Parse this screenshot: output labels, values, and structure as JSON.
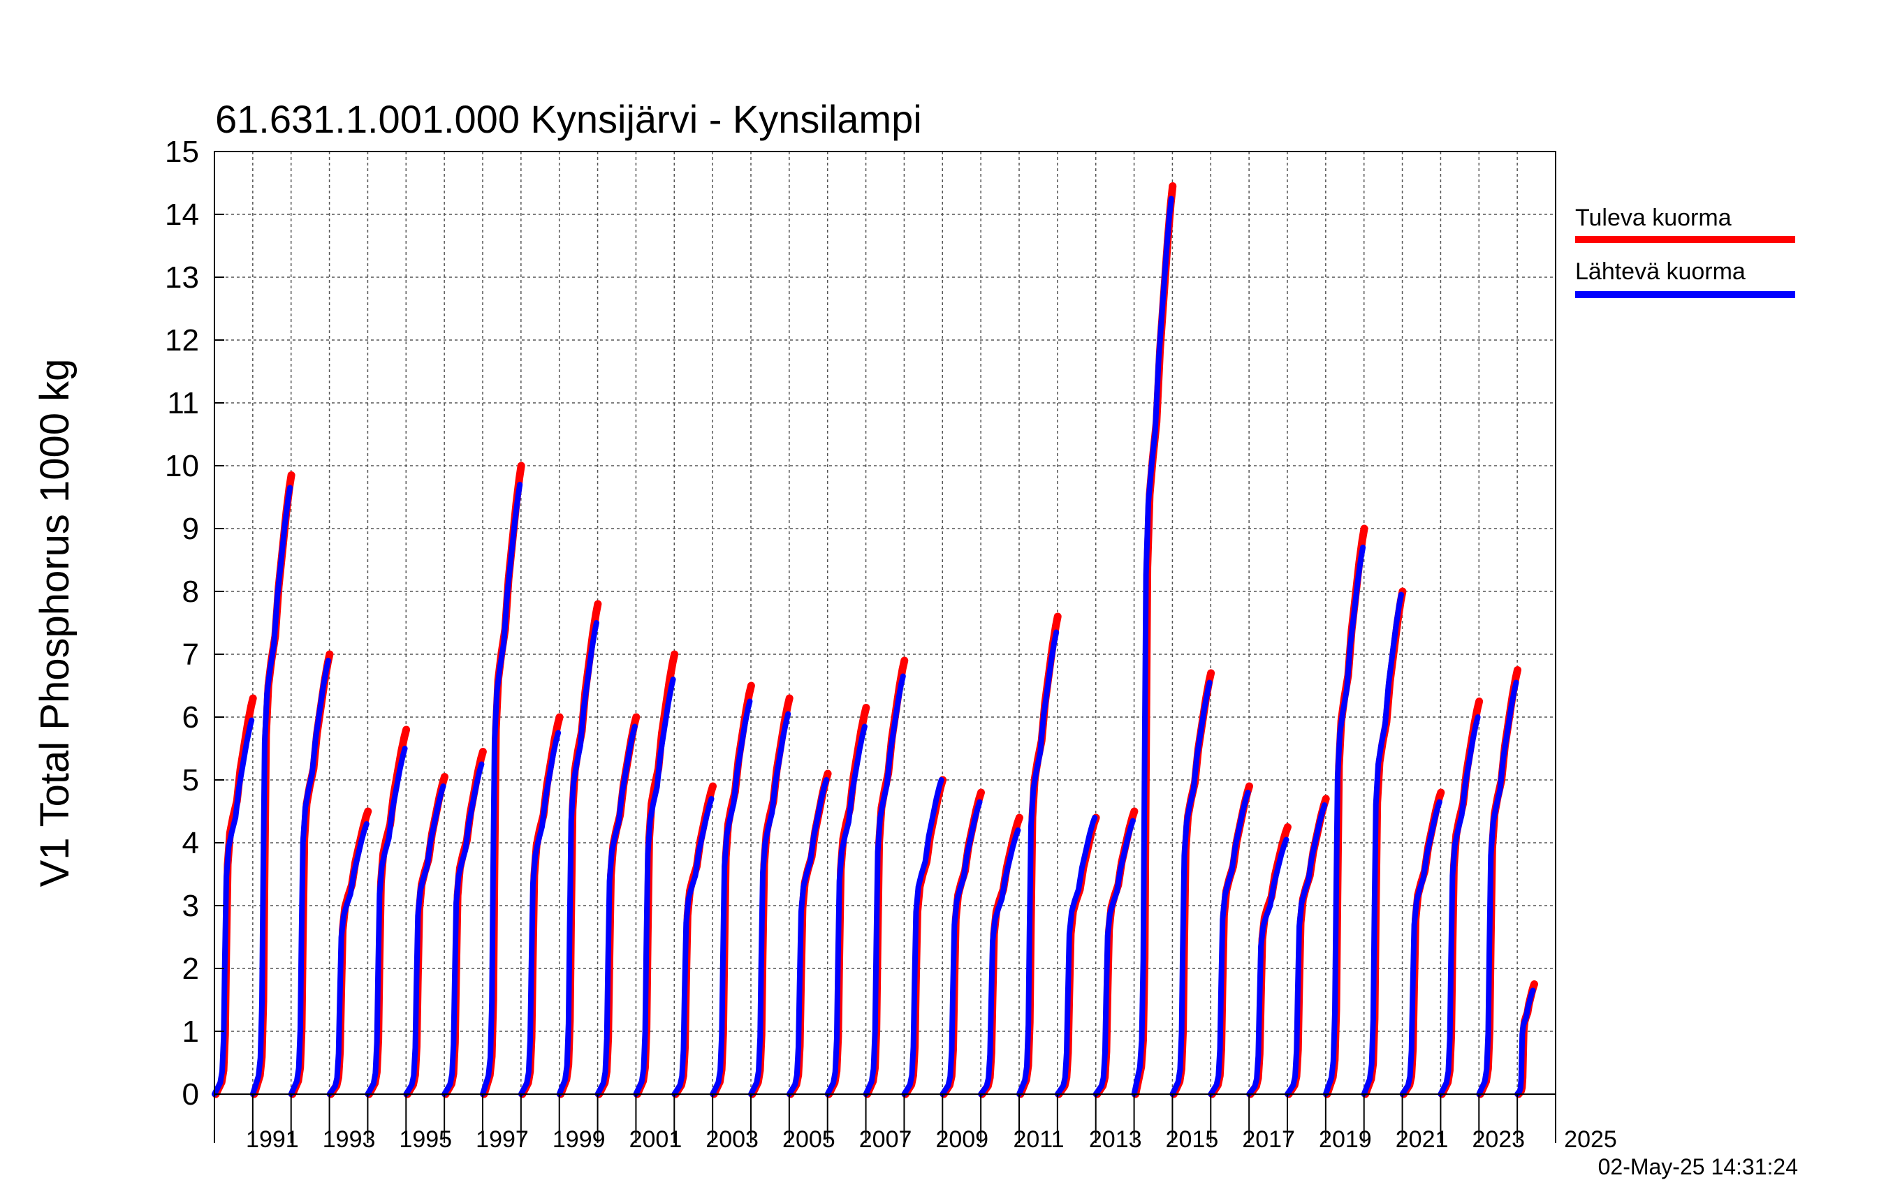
{
  "chart_data": {
    "type": "line",
    "title": "61.631.1.001.000 Kynsijärvi - Kynsilampi",
    "ylabel": "V1 Total Phosphorus 1000 kg",
    "xlabel": "",
    "timestamp": "02-May-25 14:31:24",
    "xlim": [
      1990,
      2025
    ],
    "ylim": [
      0,
      15
    ],
    "yticks": [
      "0",
      "1",
      "2",
      "3",
      "4",
      "5",
      "6",
      "7",
      "8",
      "9",
      "10",
      "11",
      "12",
      "13",
      "14",
      "15"
    ],
    "xtick_labels": [
      "1991",
      "1993",
      "1995",
      "1997",
      "1999",
      "2001",
      "2003",
      "2005",
      "2007",
      "2009",
      "2011",
      "2013",
      "2015",
      "2017",
      "2019",
      "2021",
      "2023",
      "2025"
    ],
    "grid": true,
    "legend_position": "right",
    "colors": {
      "tuleva": "#ff0000",
      "lahteva": "#0000ff",
      "grid": "#555555"
    },
    "series": [
      {
        "name": "Tuleva kuorma",
        "color": "#ff0000",
        "annual_max": [
          6.3,
          9.85,
          7.0,
          4.5,
          5.8,
          5.05,
          5.45,
          10.0,
          6.0,
          7.8,
          6.0,
          7.0,
          4.9,
          6.5,
          6.3,
          5.1,
          6.15,
          6.9,
          5.0,
          4.8,
          4.4,
          7.6,
          4.4,
          4.5,
          14.45,
          6.7,
          4.9,
          4.25,
          4.7,
          9.0,
          8.0,
          4.8,
          6.25,
          6.75,
          1.75
        ]
      },
      {
        "name": "Lähtevä kuorma",
        "color": "#0000ff",
        "annual_max": [
          5.95,
          9.65,
          6.9,
          4.3,
          5.5,
          4.9,
          5.25,
          9.7,
          5.75,
          7.5,
          5.85,
          6.6,
          4.7,
          6.25,
          6.05,
          5.0,
          5.85,
          6.65,
          5.0,
          4.65,
          4.2,
          7.35,
          4.4,
          4.35,
          14.25,
          6.55,
          4.8,
          4.05,
          4.6,
          8.7,
          7.95,
          4.65,
          6.0,
          6.55,
          1.65
        ]
      }
    ]
  }
}
